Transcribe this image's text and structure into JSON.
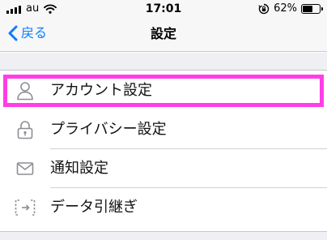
{
  "status_bar": {
    "carrier": "au",
    "time": "17:01",
    "battery_percent": "62%",
    "battery_level": 0.62,
    "icons": [
      "signal-bars-icon",
      "wifi-icon",
      "rotation-lock-icon",
      "battery-icon"
    ]
  },
  "nav": {
    "back_label": "戻る",
    "title": "設定"
  },
  "settings": {
    "items": [
      {
        "label": "アカウント設定",
        "icon": "person-icon",
        "highlighted": true
      },
      {
        "label": "プライバシー設定",
        "icon": "lock-icon"
      },
      {
        "label": "通知設定",
        "icon": "envelope-icon"
      },
      {
        "label": "データ引継ぎ",
        "icon": "data-transfer-icon"
      }
    ]
  },
  "colors": {
    "accent": "#0a7cff",
    "highlight": "#ff3ee6",
    "icon_gray": "#8e8e93",
    "group_background": "#efeff4"
  }
}
